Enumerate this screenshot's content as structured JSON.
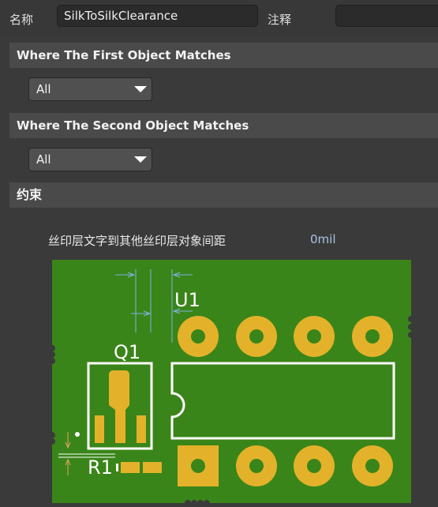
{
  "header": {
    "name_label": "名称",
    "name_value": "SilkToSilkClearance",
    "comment_label": "注释",
    "comment_value": ""
  },
  "first_object": {
    "title": "Where The First Object Matches",
    "selected": "All"
  },
  "second_object": {
    "title": "Where The Second Object Matches",
    "selected": "All"
  },
  "constraints": {
    "title": "约束",
    "rule_label": "丝印层文字到其他丝印层对象间距",
    "rule_value": "0mil"
  },
  "diagram": {
    "label_u1": "U1",
    "label_q1": "Q1",
    "label_r1": "R1",
    "colors": {
      "board": "#3a8519",
      "pad": "#e3b22a",
      "silk": "#ffffff",
      "dimension": "#7fb4e0"
    }
  }
}
